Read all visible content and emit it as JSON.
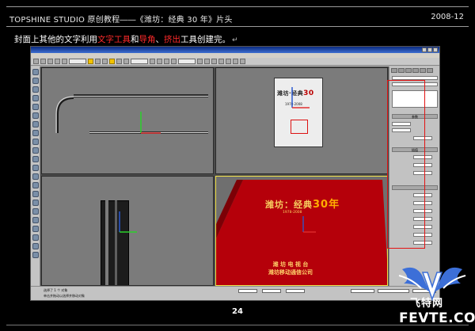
{
  "header": {
    "title": "TOPSHINE STUDIO 原创教程――《潍坊：经典 30 年》片头",
    "date": "2008-12"
  },
  "caption": {
    "part1": "封面上其他的文字利用",
    "highlight1": "文字工具",
    "part2": "和",
    "highlight2": "导角",
    "part3": "、",
    "highlight3": "挤出",
    "part4": "工具创建完。",
    "return_mark": "↵"
  },
  "page_number": "24",
  "app": {
    "cover_text": {
      "title": "潍坊·经典",
      "title_number": "30",
      "years": "1978-2008"
    },
    "perspective_text": {
      "title": "潍坊：经典",
      "title_number": "30年",
      "footer_line1": "潍  坊  电  视  台",
      "footer_line2": "潍坊移动通信公司"
    },
    "status": {
      "line1": "选择了 1 个 对象",
      "line2": "单击并拖动以选择并移动对象"
    },
    "panel": {
      "params_label": "参数",
      "line_label": "插值"
    }
  },
  "logo": {
    "cn": "飞特网",
    "en": "FEVTE.COM",
    "letter": "V"
  },
  "colors": {
    "highlight": "#ff2a2a",
    "active_viewport": "#f3e34a",
    "floor_red": "#b5000a",
    "logo_blue": "#3c6fd8"
  }
}
